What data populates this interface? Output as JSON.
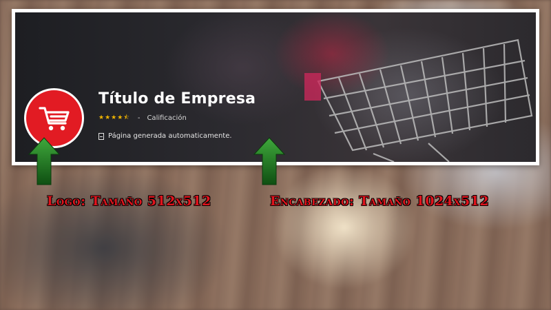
{
  "header_card": {
    "company_title": "Título de Empresa",
    "rating_stars": 4.5,
    "rating_separator": "-",
    "rating_label": "Calificación",
    "info_text": "Página generada automaticamente.",
    "logo_icon": "shopping-cart-icon",
    "info_icon": "document-icon",
    "colors": {
      "logo_bg": "#e21b23",
      "star": "#f0b400",
      "title": "#ffffff"
    }
  },
  "annotations": {
    "logo_caption": "Logo: Tamaño 512x512",
    "header_caption": "Encabezado: Tamaño 1024x512",
    "arrow_icon": "arrow-up-icon",
    "colors": {
      "caption": "#e0141d",
      "arrow": "#1f7a22"
    }
  }
}
